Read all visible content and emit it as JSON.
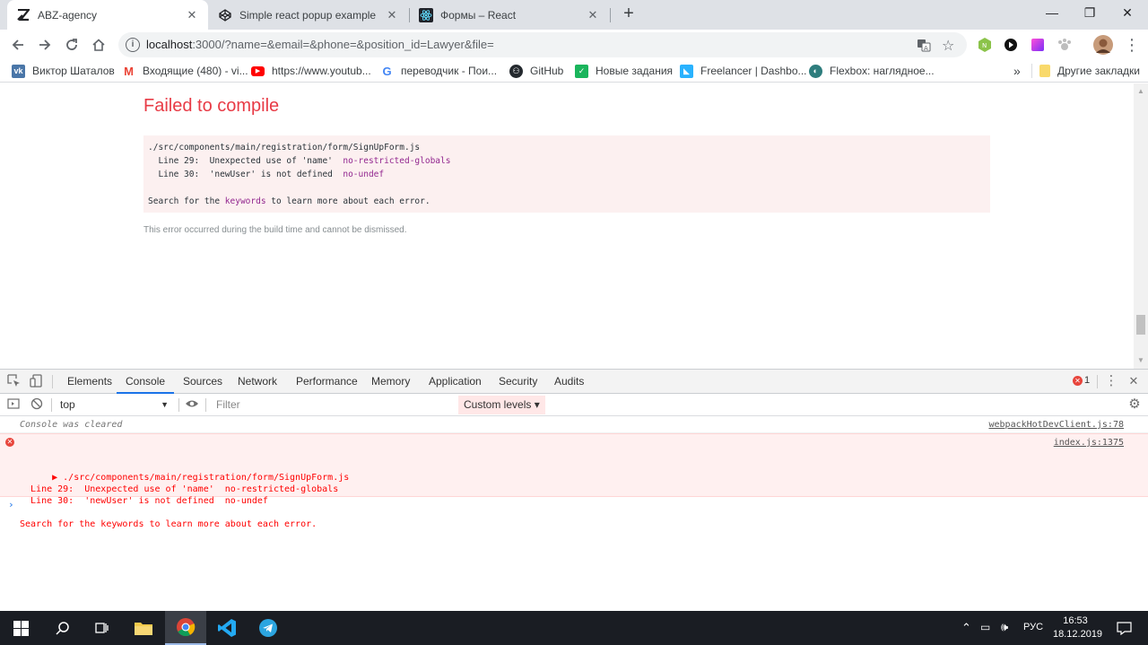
{
  "tabs": [
    {
      "label": "ABZ-agency",
      "icon": "abz-logo-icon"
    },
    {
      "label": "Simple react popup example",
      "icon": "codepen-icon"
    },
    {
      "label": "Формы – React",
      "icon": "react-icon"
    }
  ],
  "address": {
    "host": "localhost",
    "path": ":3000/?name=&email=&phone=&position_id=Lawyer&file="
  },
  "bookmarks": [
    {
      "label": "Виктор Шаталов",
      "icon": "vk-icon",
      "color": "#4a76a8"
    },
    {
      "label": "Входящие (480) - vi...",
      "icon": "gmail-icon",
      "color": "#ea4335"
    },
    {
      "label": "https://www.youtub...",
      "icon": "youtube-icon",
      "color": "#ff0000"
    },
    {
      "label": "переводчик - Пои...",
      "icon": "google-icon",
      "color": "#4285f4"
    },
    {
      "label": "GitHub",
      "icon": "github-icon",
      "color": "#24292e"
    },
    {
      "label": "Новые задания",
      "icon": "check-icon",
      "color": "#1ab55c"
    },
    {
      "label": "Freelancer | Dashbo...",
      "icon": "freelancer-icon",
      "color": "#29b2fe"
    },
    {
      "label": "Flexbox: наглядное...",
      "icon": "flexbox-icon",
      "color": "#2e7d7d"
    }
  ],
  "bookmarks_overflow": "»",
  "other_bookmarks": "Другие закладки",
  "page": {
    "title": "Failed to compile",
    "file": "./src/components/main/registration/form/SignUpForm.js",
    "line1_text": "  Line 29:  Unexpected use of 'name'  ",
    "line1_rule": "no-restricted-globals",
    "line2_text": "  Line 30:  'newUser' is not defined  ",
    "line2_rule": "no-undef",
    "search_pre": "Search for the ",
    "search_kw": "keywords",
    "search_post": " to learn more about each error.",
    "note": "This error occurred during the build time and cannot be dismissed."
  },
  "devtools": {
    "tabs": [
      "Elements",
      "Console",
      "Sources",
      "Network",
      "Performance",
      "Memory",
      "Application",
      "Security",
      "Audits"
    ],
    "active_tab": "Console",
    "error_count": "1",
    "context": "top",
    "filter_placeholder": "Filter",
    "levels": "Custom levels ▾",
    "console": {
      "cleared": "Console was cleared",
      "cleared_src": "webpackHotDevClient.js:78",
      "error_src": "index.js:1375",
      "error_text": "▶ ./src/components/main/registration/form/SignUpForm.js\n  Line 29:  Unexpected use of 'name'  no-restricted-globals\n  Line 30:  'newUser' is not defined  no-undef\n\nSearch for the keywords to learn more about each error."
    }
  },
  "taskbar": {
    "lang": "РУС",
    "time": "16:53",
    "date": "18.12.2019"
  }
}
